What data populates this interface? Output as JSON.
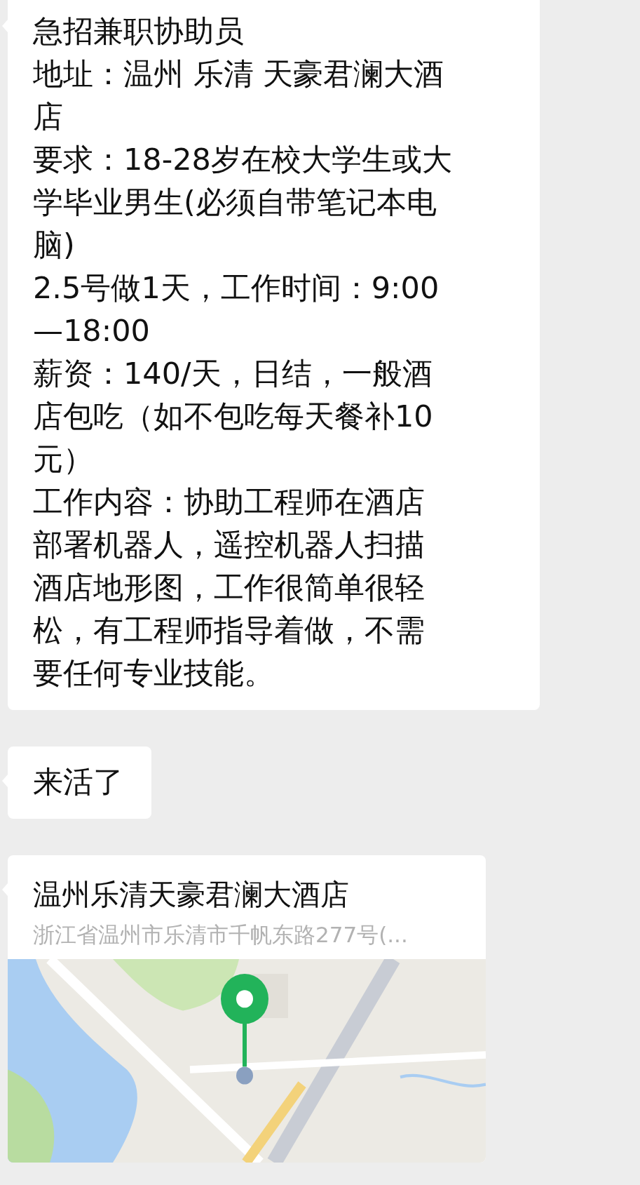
{
  "messages": [
    {
      "kind": "text",
      "lines": [
        "急招兼职协助员",
        "地址：温州 乐清 天豪君澜大酒",
        "店",
        "要求：18-28岁在校大学生或大",
        "学毕业男生(必须自带笔记本电",
        "脑)",
        "2.5号做1天，工作时间：9:00",
        "—18:00",
        "薪资：140/天，日结，一般酒",
        "店包吃（如不包吃每天餐补10",
        "元）",
        "工作内容：协助工程师在酒店",
        "部署机器人，遥控机器人扫描",
        "酒店地形图，工作很简单很轻",
        "松，有工程师指导着做，不需",
        "要任何专业技能。"
      ]
    },
    {
      "kind": "text",
      "lines": [
        "来活了"
      ]
    },
    {
      "kind": "location",
      "title": "温州乐清天豪君澜大酒店",
      "address": "浙江省温州市乐清市千帆东路277号(..."
    }
  ]
}
